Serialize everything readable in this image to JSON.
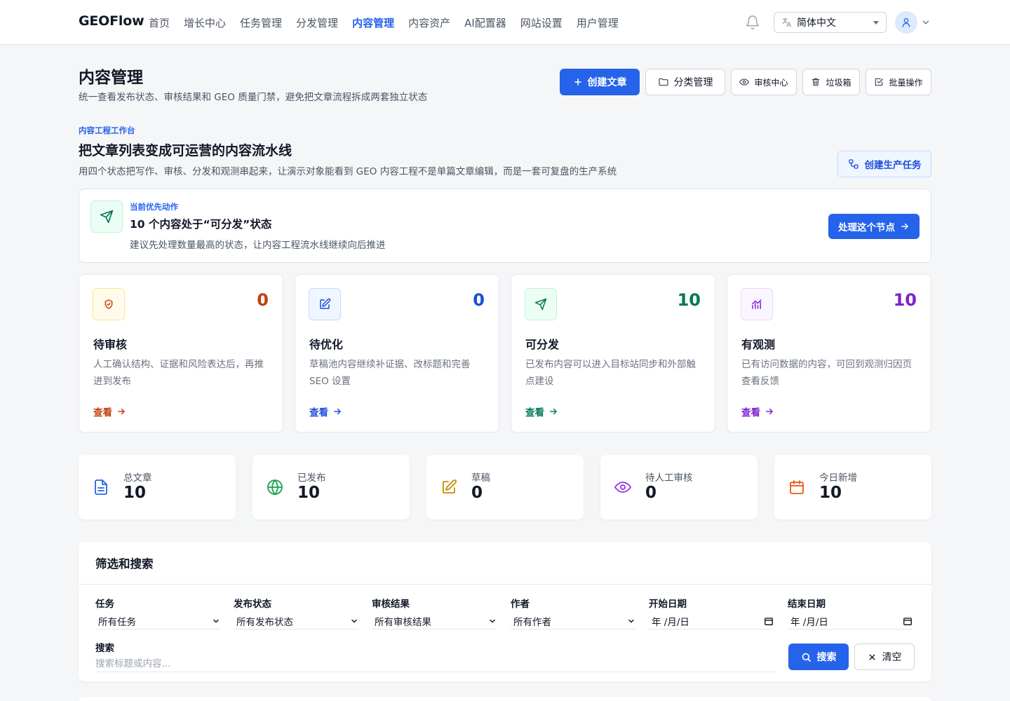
{
  "brand": "GEOFlow",
  "nav": [
    "首页",
    "增长中心",
    "任务管理",
    "分发管理",
    "内容管理",
    "内容资产",
    "AI配置器",
    "网站设置",
    "用户管理"
  ],
  "nav_active": "内容管理",
  "language": "简体中文",
  "page": {
    "title": "内容管理",
    "subtitle": "统一查看发布状态、审核结果和 GEO 质量门禁，避免把文章流程拆成两套独立状态",
    "actions": {
      "create": "创建文章",
      "category": "分类管理",
      "review": "审核中心",
      "trash": "垃圾箱",
      "batch": "批量操作"
    }
  },
  "workbench": {
    "eyebrow": "内容工程工作台",
    "title": "把文章列表变成可运营的内容流水线",
    "subtitle": "用四个状态把写作、审核、分发和观测串起来，让演示对象能看到 GEO 内容工程不是单篇文章编辑，而是一套可复盘的生产系统",
    "create_task": "创建生产任务"
  },
  "priority": {
    "label": "当前优先动作",
    "title": "10 个内容处于“可分发”状态",
    "desc": "建议先处理数量最高的状态，让内容工程流水线继续向后推进",
    "action": "处理这个节点"
  },
  "states": [
    {
      "name": "待审核",
      "count": "0",
      "desc": "人工确认结构、证据和风险表达后，再推进到发布",
      "link": "查看",
      "icon": "shield-check-icon",
      "color": "#c2410c",
      "bg": "#fffbeb",
      "border": "#fde68a"
    },
    {
      "name": "待优化",
      "count": "0",
      "desc": "草稿池内容继续补证据、改标题和完善 SEO 设置",
      "link": "查看",
      "icon": "edit-icon",
      "color": "#1d4ed8",
      "bg": "#eff6ff",
      "border": "#bfdbfe"
    },
    {
      "name": "可分发",
      "count": "10",
      "desc": "已发布内容可以进入目标站同步和外部触点建设",
      "link": "查看",
      "icon": "send-icon",
      "color": "#047857",
      "bg": "#ecfdf5",
      "border": "#bbf7d0"
    },
    {
      "name": "有观测",
      "count": "10",
      "desc": "已有访问数据的内容，可回到观测归因页查看反馈",
      "link": "查看",
      "icon": "chart-icon",
      "color": "#7e22ce",
      "bg": "#faf5ff",
      "border": "#e9d5ff"
    }
  ],
  "stats": [
    {
      "label": "总文章",
      "value": "10",
      "icon": "document-icon",
      "color": "#2563eb"
    },
    {
      "label": "已发布",
      "value": "10",
      "icon": "globe-icon",
      "color": "#16a34a"
    },
    {
      "label": "草稿",
      "value": "0",
      "icon": "edit-icon",
      "color": "#ca8a04"
    },
    {
      "label": "待人工审核",
      "value": "0",
      "icon": "eye-icon",
      "color": "#9333ea"
    },
    {
      "label": "今日新增",
      "value": "10",
      "icon": "calendar-icon",
      "color": "#ea580c"
    }
  ],
  "filter": {
    "title": "筛选和搜索",
    "fields": [
      {
        "label": "任务",
        "value": "所有任务"
      },
      {
        "label": "发布状态",
        "value": "所有发布状态"
      },
      {
        "label": "审核结果",
        "value": "所有审核结果"
      },
      {
        "label": "作者",
        "value": "所有作者"
      },
      {
        "label": "开始日期",
        "value": "年 /月/日"
      },
      {
        "label": "结束日期",
        "value": "年 /月/日"
      }
    ],
    "search_label": "搜索",
    "search_placeholder": "搜索标题或内容...",
    "search_button": "搜索",
    "clear_button": "清空"
  }
}
